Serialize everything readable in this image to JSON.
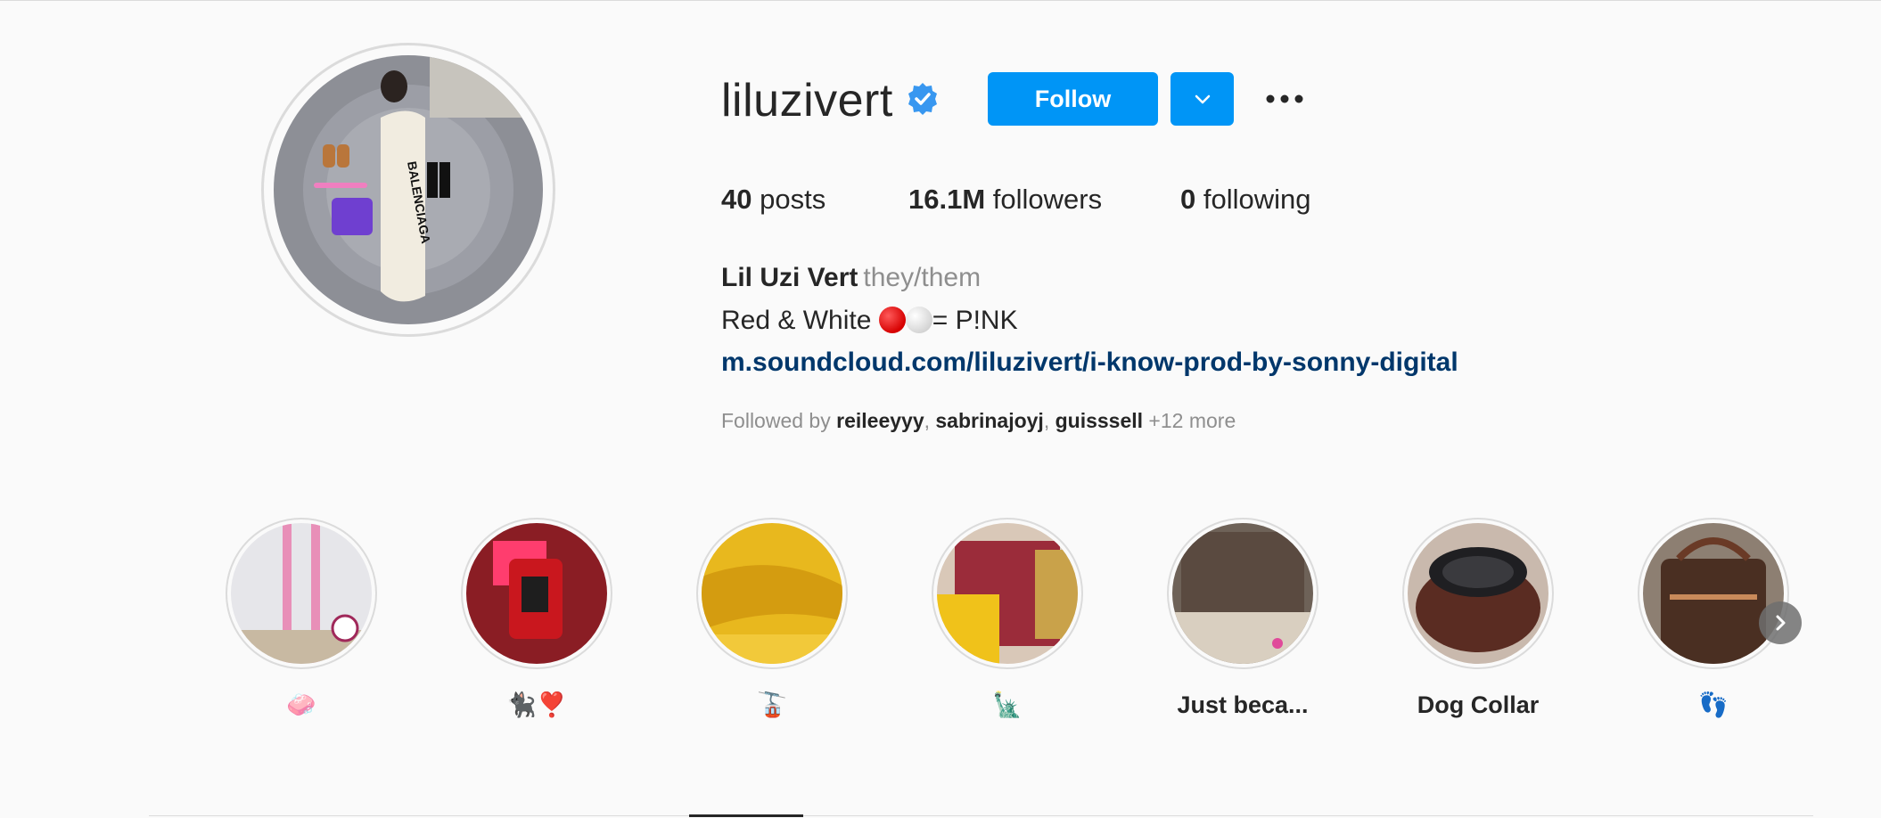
{
  "profile": {
    "username": "liluzivert",
    "verified_icon": "verified-badge-icon",
    "follow_label": "Follow",
    "dropdown_icon": "chevron-down-icon",
    "more_icon": "more-options-icon",
    "avatar_icon": "profile-photo"
  },
  "stats": {
    "posts_count": "40",
    "posts_label": "posts",
    "followers_count": "16.1M",
    "followers_label": "followers",
    "following_count": "0",
    "following_label": "following"
  },
  "bio": {
    "full_name": "Lil Uzi Vert",
    "pronouns": "they/them",
    "line_prefix": "Red & White ",
    "line_suffix": "= P!NK",
    "link": "m.soundcloud.com/liluzivert/i-know-prod-by-sonny-digital"
  },
  "followed_by": {
    "prefix": "Followed by ",
    "users": [
      "reileeyyy",
      "sabrinajoyj",
      "guisssell"
    ],
    "separator": ", ",
    "more": " +12 more"
  },
  "highlights": [
    {
      "label": "🧼"
    },
    {
      "label": "🐈‍⬛❣️"
    },
    {
      "label": "🚡"
    },
    {
      "label": "🗽"
    },
    {
      "label": "Just beca..."
    },
    {
      "label": "Dog Collar"
    },
    {
      "label": "👣"
    }
  ],
  "colors": {
    "accent": "#0095f6",
    "link": "#00376b",
    "secondary_text": "#8e8e8e",
    "border": "#dbdbdb"
  }
}
